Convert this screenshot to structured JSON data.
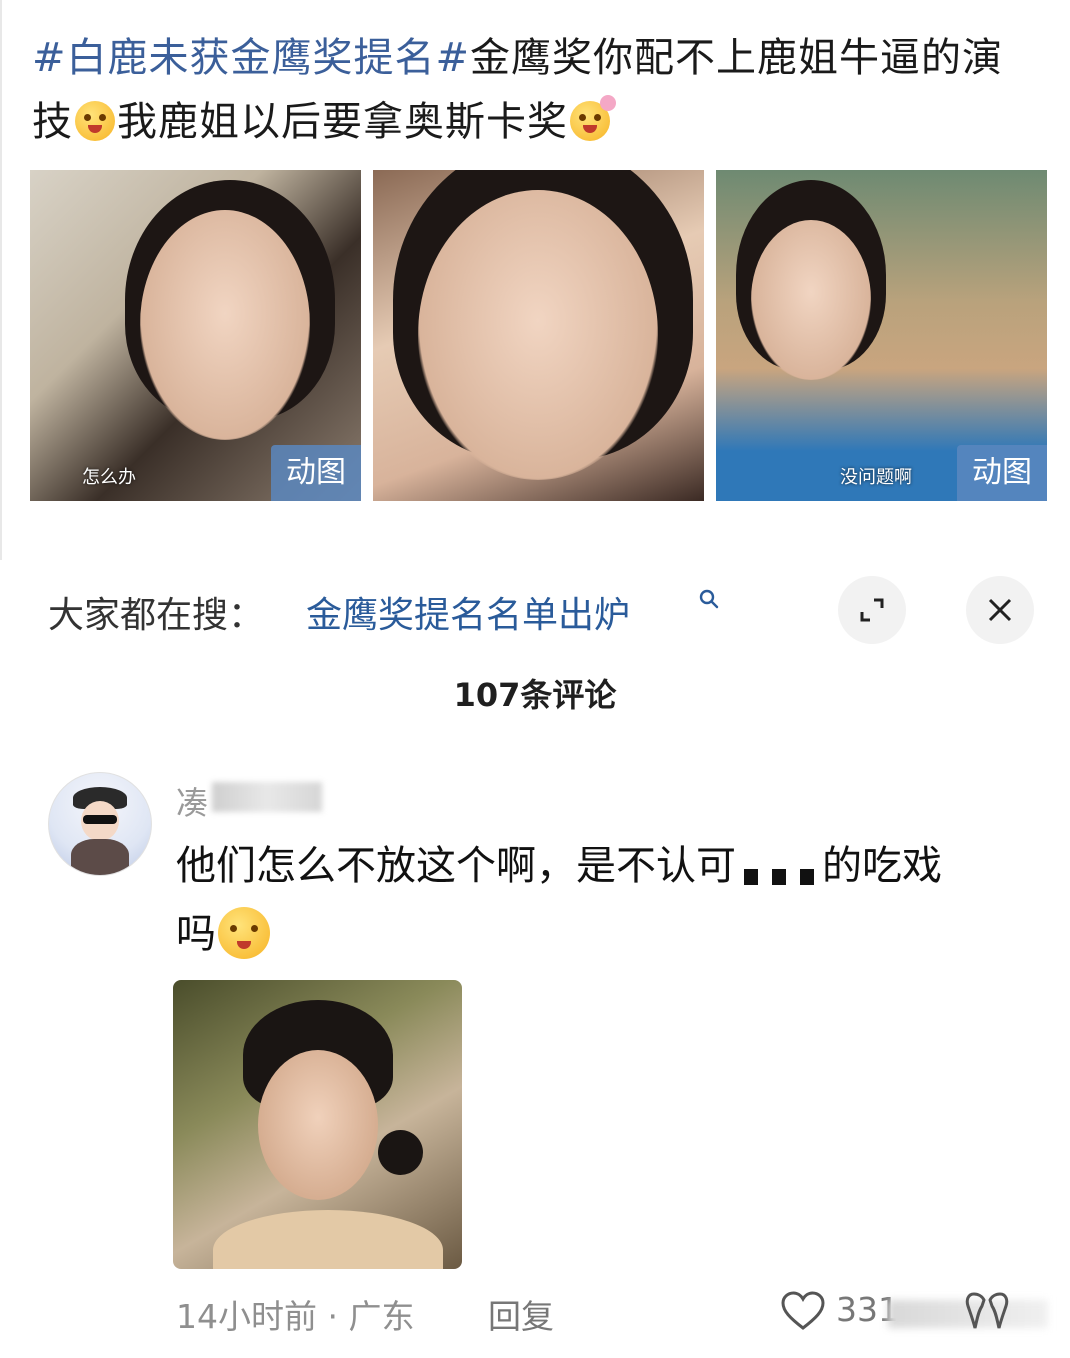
{
  "post": {
    "hashtag": "#白鹿未获金鹰奖提名#",
    "text_part1": "金鹰奖你配不上鹿姐牛逼的演技",
    "text_part2": "我鹿姐以后要拿奥斯卡奖",
    "images": [
      {
        "caption": "怎么办",
        "badge": "动图"
      },
      {
        "caption": "",
        "badge": ""
      },
      {
        "caption": "没问题啊",
        "badge": "动图"
      }
    ]
  },
  "search": {
    "label": "大家都在搜：",
    "query": "金鹰奖提名名单出炉"
  },
  "comments_header": "107条评论",
  "comment": {
    "username": "凑",
    "text_before": "他们怎么不放这个啊，是不认可",
    "text_after": "的吃戏",
    "text_end": "吗",
    "meta": "14小时前 · 广东",
    "reply_label": "回复",
    "likes": "331"
  },
  "colors": {
    "hashtag": "#3b5f9a",
    "search_link": "#2a5b9a",
    "badge": "#5a87be"
  }
}
